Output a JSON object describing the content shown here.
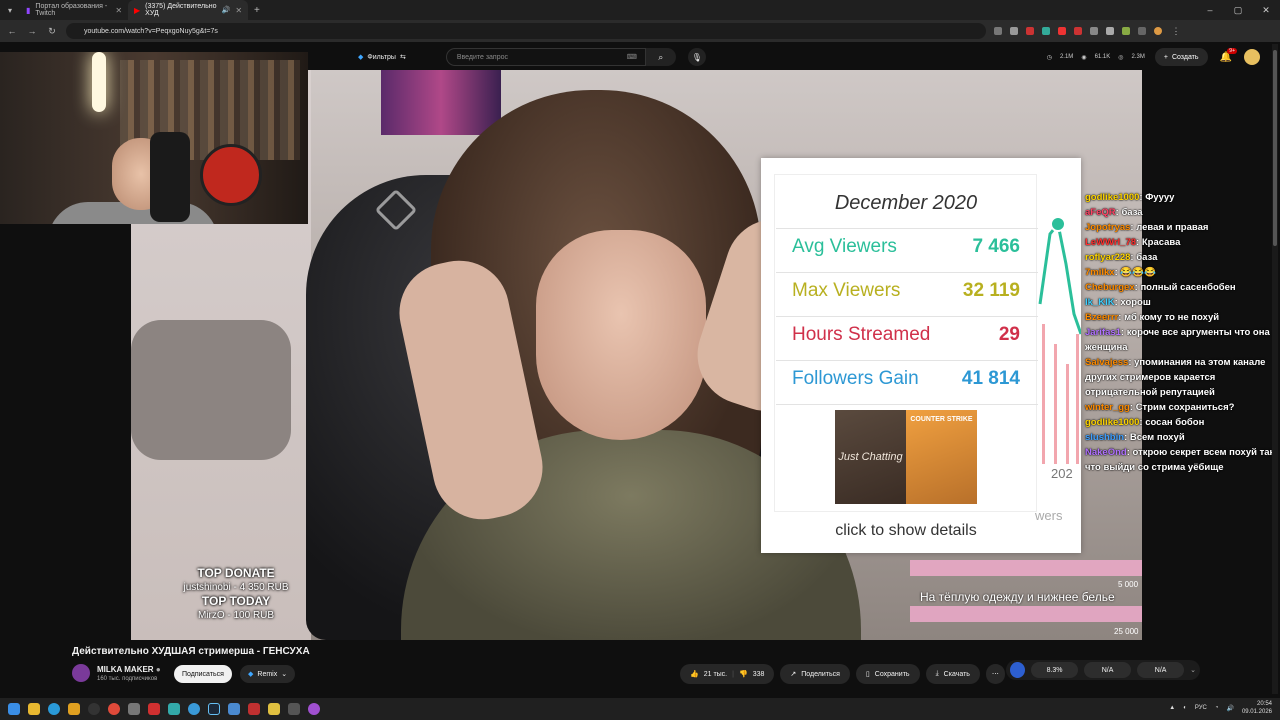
{
  "browser": {
    "tabs": [
      {
        "title": "Портал образования - Twitch"
      },
      {
        "title": "(3375) Действительно ХУД"
      }
    ],
    "url": "youtube.com/watch?v=PeqxgoNuy5g&t=7s"
  },
  "yt_header": {
    "filters_label": "Фильтры",
    "search_placeholder": "Введите запрос",
    "stats": [
      "2.1M",
      "61.1K",
      "2.3M"
    ],
    "create_label": "Создать",
    "notif_count": "9+"
  },
  "overlay": {
    "top_donate_title": "TOP DONATE",
    "top_donate_entry": "justshinobi - 4 350 RUB",
    "top_today_title": "TOP TODAY",
    "top_today_entry": "MirzO - 100 RUB",
    "donation_text": "На тёплую одежду и нижнее белье",
    "donation_mark_1": "5 000",
    "donation_mark_2": "25 000"
  },
  "stats_card": {
    "month": "December 2020",
    "rows": [
      {
        "label": "Avg Viewers",
        "value": "7 466",
        "color": "#2bbf9a"
      },
      {
        "label": "Max Viewers",
        "value": "32 119",
        "color": "#b8b020"
      },
      {
        "label": "Hours Streamed",
        "value": "29",
        "color": "#d0304a"
      },
      {
        "label": "Followers Gain",
        "value": "41 814",
        "color": "#2d98d4"
      }
    ],
    "thumb_a": "Just Chatting",
    "thumb_b": "COUNTER STRIKE",
    "footer": "click to show details",
    "year_label": "202",
    "bg_text": "wers"
  },
  "chat": [
    {
      "user": "godlike1000",
      "color": "#ffd500",
      "msg": "Фуууу"
    },
    {
      "user": "aFeQR",
      "color": "#ff4466",
      "msg": "база"
    },
    {
      "user": "Jopotryas",
      "color": "#ff8c00",
      "msg": "левая и правая"
    },
    {
      "user": "LeWWrl_78",
      "color": "#ff3030",
      "msg": "Красава"
    },
    {
      "user": "roflyar228",
      "color": "#ffd500",
      "msg": "база"
    },
    {
      "user": "7milkx",
      "color": "#ff8c00",
      "msg": "😂😂😂"
    },
    {
      "user": "Cheburgex",
      "color": "#ff8c00",
      "msg": "полный сасенбобен"
    },
    {
      "user": "Ik_KIK",
      "color": "#3fd0ff",
      "msg": "хорош"
    },
    {
      "user": "Bzeerrr",
      "color": "#ff8c00",
      "msg": "мб кому то не похуй"
    },
    {
      "user": "Jarifas1",
      "color": "#b070ff",
      "msg": "короче все аргументы что она женщина"
    },
    {
      "user": "Salvajess",
      "color": "#ff8c00",
      "msg": "упоминания на этом канале других стримеров карается отрицательной репутацией"
    },
    {
      "user": "winter_gg",
      "color": "#ff8c00",
      "msg": "Стрим сохраниться?"
    },
    {
      "user": "godlike1000",
      "color": "#ffd500",
      "msg": "сосан бобон"
    },
    {
      "user": "slushbin",
      "color": "#3fa0ff",
      "msg": "Всем похуй"
    },
    {
      "user": "NakeOnd",
      "color": "#b070ff",
      "msg": "открою секрет всем похуй так что выйди со стрима уёбище"
    }
  ],
  "video_meta": {
    "title": "Действительно ХУДШАЯ стримерша - ГЕНСУХА",
    "channel": "MILKA MAKER",
    "subs": "160 тыс. подписчиков",
    "subscribe_label": "Подписаться",
    "remix_label": "Remix",
    "likes": "21 тыс.",
    "dislikes": "338",
    "share_label": "Поделиться",
    "save_label": "Сохранить",
    "download_label": "Скачать",
    "ext_values": [
      "8.3%",
      "N/A",
      "N/A"
    ]
  },
  "taskbar": {
    "lang": "РУС",
    "time": "20:54",
    "date": "09.01.2026"
  }
}
